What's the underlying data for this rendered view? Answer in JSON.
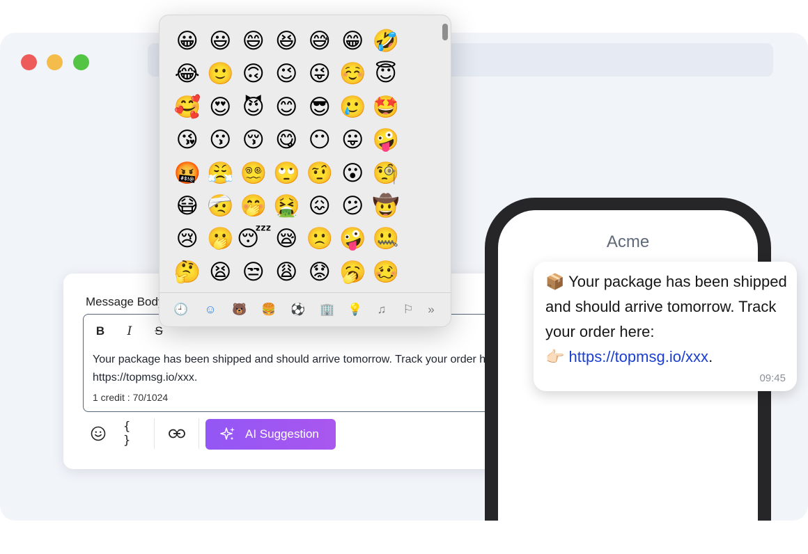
{
  "window": {
    "traffic_lights": [
      "close",
      "minimize",
      "zoom"
    ],
    "colors": {
      "red": "#ee5b5b",
      "yellow": "#f4bd4b",
      "green": "#54c444"
    }
  },
  "composer": {
    "label": "Message Body",
    "format_buttons": {
      "bold": "B",
      "italic": "I",
      "strike": "S"
    },
    "message_line1": "Your package has been shipped and should arrive tomorrow. Track your order here:",
    "message_line2": "https://topmsg.io/xxx.",
    "credit_counter": "1 credit : 70/1024",
    "toolbar": {
      "emoji_icon": "smiley-icon",
      "variables_label": "{ }",
      "link_icon": "link-icon",
      "ai_suggestion_label": "AI Suggestion"
    },
    "accent_color": "#9a57f3"
  },
  "phone": {
    "sender_name": "Acme",
    "bubble": {
      "package_emoji": "📦",
      "text": "Your package has been shipped and should arrive tomorrow. Track your order here:",
      "pointer_emoji": "👉🏻",
      "link": "https://topmsg.io/xxx",
      "link_suffix": ".",
      "time": "09:45"
    },
    "link_color": "#1a3fcf"
  },
  "emoji_picker": {
    "emojis": [
      "😀",
      "😃",
      "😄",
      "😆",
      "😅",
      "😁",
      "🤣",
      "😂",
      "🙂",
      "🙃",
      "😉",
      "😜",
      "☺️",
      "😇",
      "🥰",
      "😍",
      "😈",
      "😊",
      "😎",
      "🥲",
      "🤩",
      "😘",
      "😗",
      "😚",
      "😋",
      "😶",
      "😛",
      "🤪",
      "🤬",
      "😤",
      "😵‍💫",
      "🙄",
      "🤨",
      "😮",
      "🧐",
      "😷",
      "🤕",
      "🤭",
      "🤮",
      "😖",
      "😕",
      "🤠",
      "😢",
      "🫢",
      "😴",
      "😪",
      "🙁",
      "🤪",
      "🤐",
      "🤔",
      "😫",
      "😒",
      "😩",
      "😟",
      "🥱",
      "🥴"
    ],
    "categories": [
      {
        "name": "recent-icon",
        "glyph": "🕘"
      },
      {
        "name": "smileys-icon",
        "glyph": "☺"
      },
      {
        "name": "animals-icon",
        "glyph": "🐻"
      },
      {
        "name": "food-icon",
        "glyph": "🍔"
      },
      {
        "name": "activity-icon",
        "glyph": "⚽"
      },
      {
        "name": "travel-icon",
        "glyph": "🏢"
      },
      {
        "name": "objects-icon",
        "glyph": "💡"
      },
      {
        "name": "symbols-icon",
        "glyph": "♫"
      },
      {
        "name": "flags-icon",
        "glyph": "⚐"
      },
      {
        "name": "more-icon",
        "glyph": "»"
      }
    ]
  }
}
